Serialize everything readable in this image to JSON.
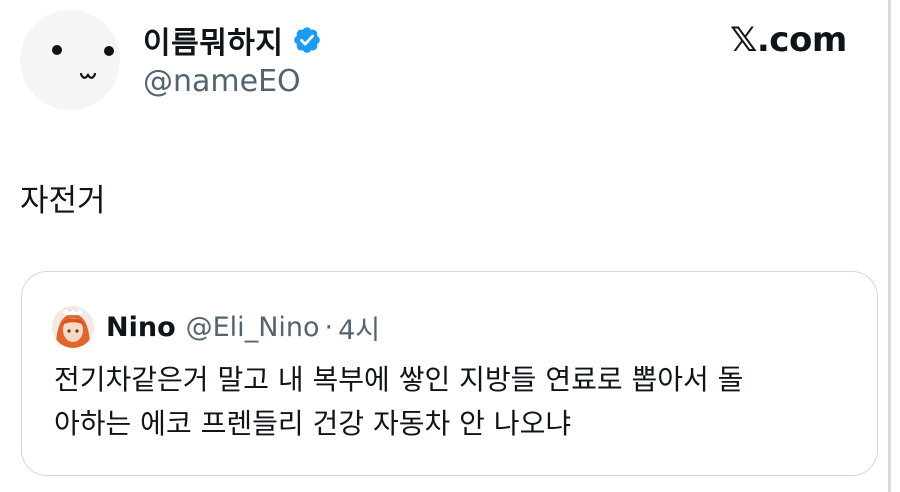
{
  "author": {
    "display_name": "이름뭐하지",
    "handle": "@nameEO",
    "verified": true,
    "avatar": "smiley-face"
  },
  "brand": {
    "label": "𝕏.com"
  },
  "tweet": {
    "text": "자전거"
  },
  "quoted_tweet": {
    "name": "Nino",
    "handle": "@Eli_Nino",
    "separator": "·",
    "time": "4시",
    "lines": [
      "전기차같은거 말고 내 복부에 쌓인 지방들 연료로 뽑아서 돌",
      "아하는 에코 프렌들리 건강 자동차 안 나오냐"
    ]
  },
  "colors": {
    "text_primary": "#0f1419",
    "text_secondary": "#536471",
    "verified_blue": "#1d9bf0",
    "card_border": "#cfd9de",
    "avatar_bg": "#f5f5f5"
  },
  "icons": [
    "verified-badge-icon",
    "x-logo"
  ]
}
